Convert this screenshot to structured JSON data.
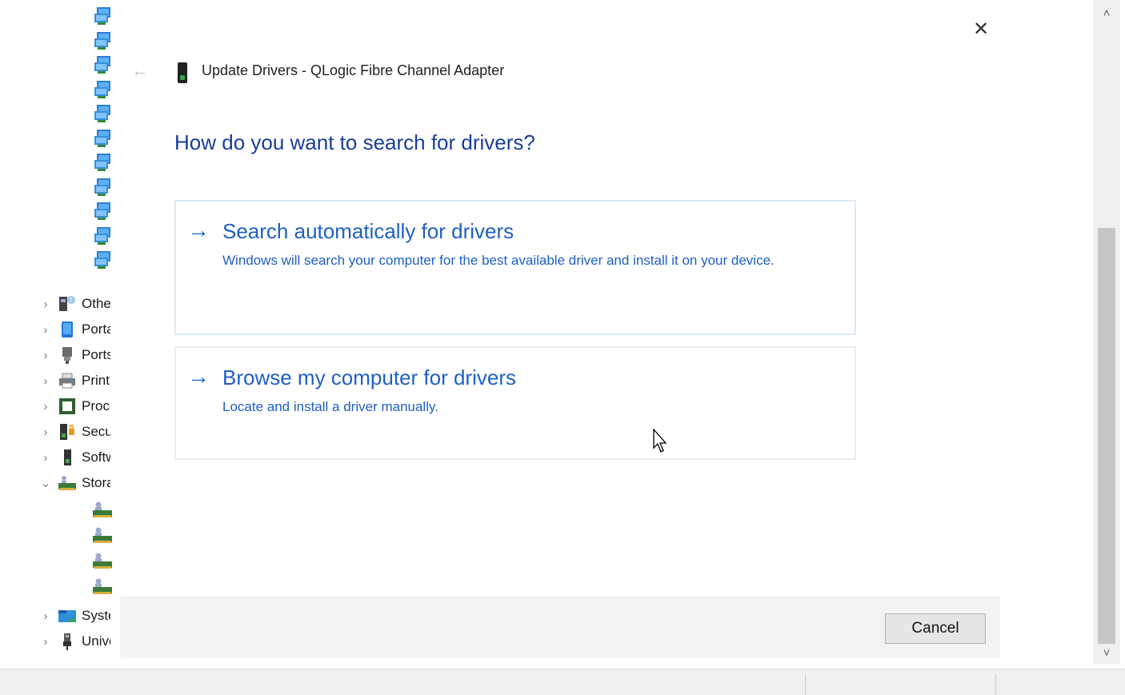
{
  "tree": {
    "network_adapter_count": 11,
    "categories": [
      {
        "label": "Other devices",
        "expanded": false,
        "icon": "other-devices-icon"
      },
      {
        "label": "Portable Devices",
        "expanded": false,
        "icon": "portable-device-icon"
      },
      {
        "label": "Ports (COM & LPT)",
        "expanded": false,
        "icon": "port-icon"
      },
      {
        "label": "Print queues",
        "expanded": false,
        "icon": "printer-icon"
      },
      {
        "label": "Processors",
        "expanded": false,
        "icon": "processor-icon"
      },
      {
        "label": "Security devices",
        "expanded": false,
        "icon": "security-device-icon"
      },
      {
        "label": "Software devices",
        "expanded": false,
        "icon": "software-device-icon"
      },
      {
        "label": "Storage controllers",
        "expanded": true,
        "icon": "storage-controller-icon"
      },
      {
        "label": "System devices",
        "expanded": false,
        "icon": "system-devices-icon"
      },
      {
        "label": "Universal Serial Bus controllers",
        "expanded": false,
        "icon": "usb-icon"
      }
    ],
    "storage_children_count": 4
  },
  "dialog": {
    "title": "Update Drivers - QLogic Fibre Channel Adapter",
    "heading": "How do you want to search for drivers?",
    "options": [
      {
        "title": "Search automatically for drivers",
        "description": "Windows will search your computer for the best available driver and install it on your device."
      },
      {
        "title": "Browse my computer for drivers",
        "description": "Locate and install a driver manually."
      }
    ],
    "cancel_label": "Cancel",
    "close_glyph": "✕",
    "back_glyph": "←",
    "arrow_glyph": "→"
  },
  "scrollbar": {
    "up_glyph": "˄",
    "down_glyph": "˅"
  },
  "colors": {
    "link_blue": "#1f5fc6",
    "heading_blue": "#1a3d9a",
    "arrow_blue": "#1565d8"
  }
}
